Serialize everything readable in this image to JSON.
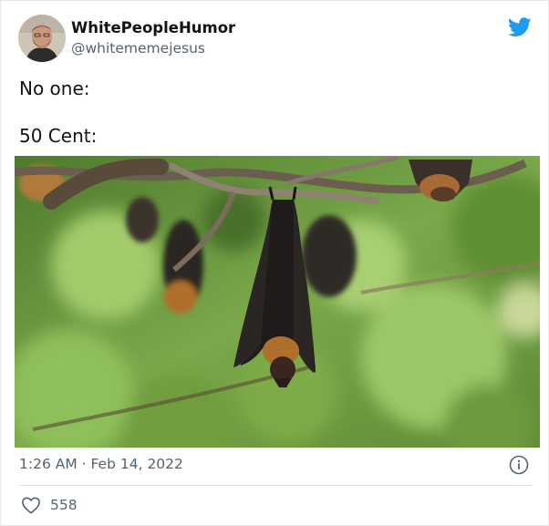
{
  "tweet": {
    "display_name": "WhitePeopleHumor",
    "handle": "@whitememejesus",
    "text_line_1": "No one:",
    "text_line_2": "50 Cent:",
    "timestamp": "1:26 AM · Feb 14, 2022",
    "like_count": "558"
  },
  "icons": {
    "brand": "twitter-bird-icon",
    "info": "info-icon",
    "like": "heart-icon"
  },
  "colors": {
    "twitter_blue": "#1d9bf0",
    "secondary_text": "#536471",
    "primary_text": "#0f1419"
  }
}
